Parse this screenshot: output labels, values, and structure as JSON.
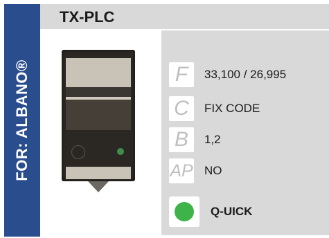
{
  "brand": {
    "label": "FOR: ALBANO®"
  },
  "header": {
    "title": "TX-PLC"
  },
  "specs": [
    {
      "letter": "F",
      "value": "33,100 / 26,995"
    },
    {
      "letter": "C",
      "value": "FIX CODE"
    },
    {
      "letter": "B",
      "value": "1,2"
    },
    {
      "letter": "AP",
      "value": "NO"
    }
  ],
  "quick": {
    "label": "Q-UICK",
    "status_color": "#3db34a"
  },
  "colors": {
    "side_tab": "#2a4d8e",
    "header_bg": "#d9d9d9",
    "info_bg": "#d9d9d9"
  }
}
